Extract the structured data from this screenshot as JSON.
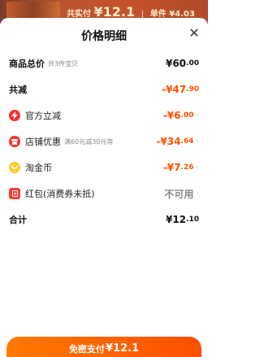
{
  "top_strip": {
    "paid_prefix": "共实付",
    "paid_amount": "¥12.1",
    "unit_prefix": "单件",
    "unit_amount": "¥4.03"
  },
  "sheet": {
    "title": "价格明细",
    "close_glyph": "✕"
  },
  "rows": {
    "total": {
      "label": "商品总价",
      "sub": "共3件宝贝",
      "value_int": "¥60",
      "value_dec": ".00"
    },
    "reduce": {
      "label": "共减",
      "value_int": "-¥47",
      "value_dec": ".90"
    },
    "official": {
      "label": "官方立减",
      "value_int": "-¥6",
      "value_dec": ".00",
      "icon": "lightning-icon"
    },
    "shop": {
      "label": "店铺优惠",
      "sub": "满60元减30元等",
      "value_int": "-¥34",
      "value_dec": ".64",
      "icon": "shop-icon"
    },
    "gold": {
      "label": "淘金币",
      "value_int": "-¥7",
      "value_dec": ".26",
      "icon": "coin-icon"
    },
    "redpacket": {
      "label": "红包(消费券未抵)",
      "value": "不可用",
      "icon": "red-packet-icon"
    },
    "subtotal": {
      "label": "合计",
      "value_int": "¥12",
      "value_dec": ".10"
    }
  },
  "chevron": "›",
  "pay_button": {
    "label": "免密支付",
    "amount": "¥12.1"
  },
  "colors": {
    "accent": "#ff5000",
    "button_start": "#ff7a00",
    "button_end": "#ff4f00"
  }
}
